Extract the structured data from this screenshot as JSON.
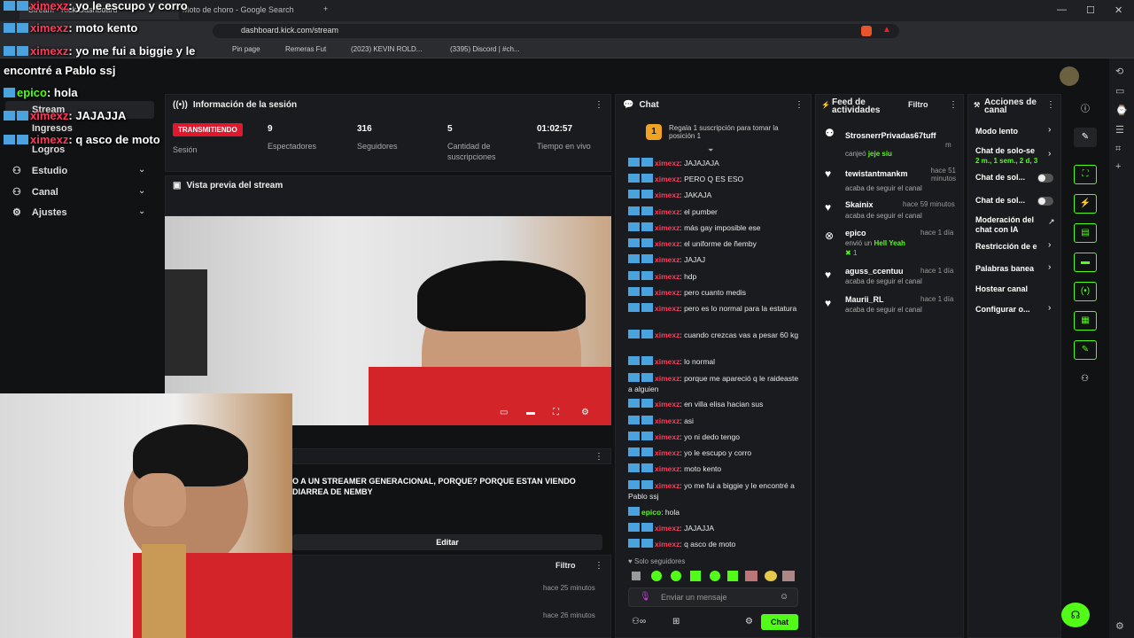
{
  "browser": {
    "tabs": [
      "Stream - Kick Dashboard",
      "Moto de choro - Google Search"
    ],
    "new_tab": "+",
    "url": "dashboard.kick.com/stream",
    "bookmarks": [
      "Pin page",
      "Remeras Fut",
      "(2023) KEVIN ROLD...",
      "(3395) Discord | #ch..."
    ],
    "controls": [
      "—",
      "☐",
      "✕"
    ]
  },
  "sidebar": {
    "items": [
      {
        "label": "Stream"
      },
      {
        "label": "Ingresos"
      },
      {
        "label": "Logros"
      },
      {
        "label": "Estudio"
      },
      {
        "label": "Canal"
      },
      {
        "label": "Ajustes"
      }
    ]
  },
  "overlay_chat": [
    {
      "user": "ximexz",
      "text": ": yo le escupo y corro"
    },
    {
      "user": "ximexz",
      "text": ": moto kento"
    },
    {
      "user": "ximexz",
      "text": ": yo me fui a biggie y le"
    },
    {
      "user": "",
      "text": "encontré a Pablo ssj"
    },
    {
      "user": "epico",
      "text": ": hola"
    },
    {
      "user": "ximexz",
      "text": ": JAJAJJA"
    },
    {
      "user": "ximexz",
      "text": ": q asco de moto"
    }
  ],
  "session": {
    "title": "Información de la sesión",
    "badge": "TRANSMITIENDO",
    "badge_sub": "Sesión",
    "stats": [
      {
        "value": "9",
        "label": "Espectadores"
      },
      {
        "value": "316",
        "label": "Seguidores"
      },
      {
        "value": "5",
        "label": "Cantidad de suscripciones"
      },
      {
        "value": "01:02:57",
        "label": "Tiempo en vivo"
      }
    ]
  },
  "preview": {
    "title": "Vista previa del stream"
  },
  "stream_info": {
    "title_text": "O A UN STREAMER GENERACIONAL, PORQUE? PORQUE ESTAN VIENDO DIARREA DE NEMBY",
    "edit": "Editar"
  },
  "bottom_feed": {
    "filter": "Filtro",
    "times": [
      "hace 25 minutos",
      "hace 26 minutos"
    ]
  },
  "chat": {
    "title": "Chat",
    "promo": "Regala 1 suscripción para tomar la posición 1",
    "promo_num": "1",
    "messages": [
      {
        "user": "ximexz",
        "text": ": JAJAJAJA"
      },
      {
        "user": "ximexz",
        "text": ": PERO Q ES ESO"
      },
      {
        "user": "ximexz",
        "text": ": JAKAJA"
      },
      {
        "user": "ximexz",
        "text": ": el pumber"
      },
      {
        "user": "ximexz",
        "text": ": más gay imposible ese"
      },
      {
        "user": "ximexz",
        "text": ": el uniforme de ñemby"
      },
      {
        "user": "ximexz",
        "text": ": JAJAJ"
      },
      {
        "user": "ximexz",
        "text": ": hdp"
      },
      {
        "user": "ximexz",
        "text": ": pero cuanto medis"
      },
      {
        "user": "ximexz",
        "text": ": pero es lo normal para la estatura"
      },
      {
        "user": "ximexz",
        "text": ": cuando crezcas vas a pesar 60 kg"
      },
      {
        "user": "ximexz",
        "text": ": lo normal"
      },
      {
        "user": "ximexz",
        "text": ": porque me apareció q le raideaste a alguien"
      },
      {
        "user": "ximexz",
        "text": ": en villa elisa hacian sus"
      },
      {
        "user": "ximexz",
        "text": ": asi"
      },
      {
        "user": "ximexz",
        "text": ": yo ni dedo tengo"
      },
      {
        "user": "ximexz",
        "text": ": yo le escupo y corro"
      },
      {
        "user": "ximexz",
        "text": ": moto kento"
      },
      {
        "user": "ximexz",
        "text": ": yo me fui a biggie y le encontré a Pablo ssj"
      },
      {
        "user": "epico",
        "text": ": hola"
      },
      {
        "user": "ximexz",
        "text": ": JAJAJJA"
      },
      {
        "user": "ximexz",
        "text": ": q asco de moto"
      }
    ],
    "followers_only": "Solo seguidores",
    "placeholder": "Enviar un mensaje",
    "send": "Chat"
  },
  "feed": {
    "title": "Feed de actividades",
    "filter": "Filtro",
    "items": [
      {
        "name": "StrosnerrPrivadas67tuff",
        "sub": "canjeó",
        "sub2": "jeje siu",
        "time": "m"
      },
      {
        "name": "tewistantmankm",
        "sub": "acaba de seguir el canal",
        "time": "hace 51 minutos"
      },
      {
        "name": "Skainix",
        "sub": "acaba de seguir el canal",
        "time": "hace 59 minutos"
      },
      {
        "name": "epico",
        "sub": "envió un",
        "sub2": "Hell Yeah",
        "extra": "1",
        "time": "hace 1 día"
      },
      {
        "name": "aguss_ccentuu",
        "sub": "acaba de seguir el canal",
        "time": "hace 1 día"
      },
      {
        "name": "Maurii_RL",
        "sub": "acaba de seguir el canal",
        "time": "hace 1 día"
      }
    ]
  },
  "actions": {
    "title": "Acciones de canal",
    "items": [
      {
        "label": "Modo lento"
      },
      {
        "label": "Chat de solo-se",
        "sub": "2 m., 1 sem., 2 d, 3"
      },
      {
        "label": "Chat de sol..."
      },
      {
        "label": "Chat de sol..."
      },
      {
        "label": "Moderación del chat con IA"
      },
      {
        "label": "Restricción de e"
      },
      {
        "label": "Palabras banea"
      },
      {
        "label": "Hostear canal"
      },
      {
        "label": "Configurar o..."
      }
    ]
  },
  "colors": {
    "accent": "#53fc18",
    "live": "#e0182d",
    "user": "#ff3b5c"
  }
}
